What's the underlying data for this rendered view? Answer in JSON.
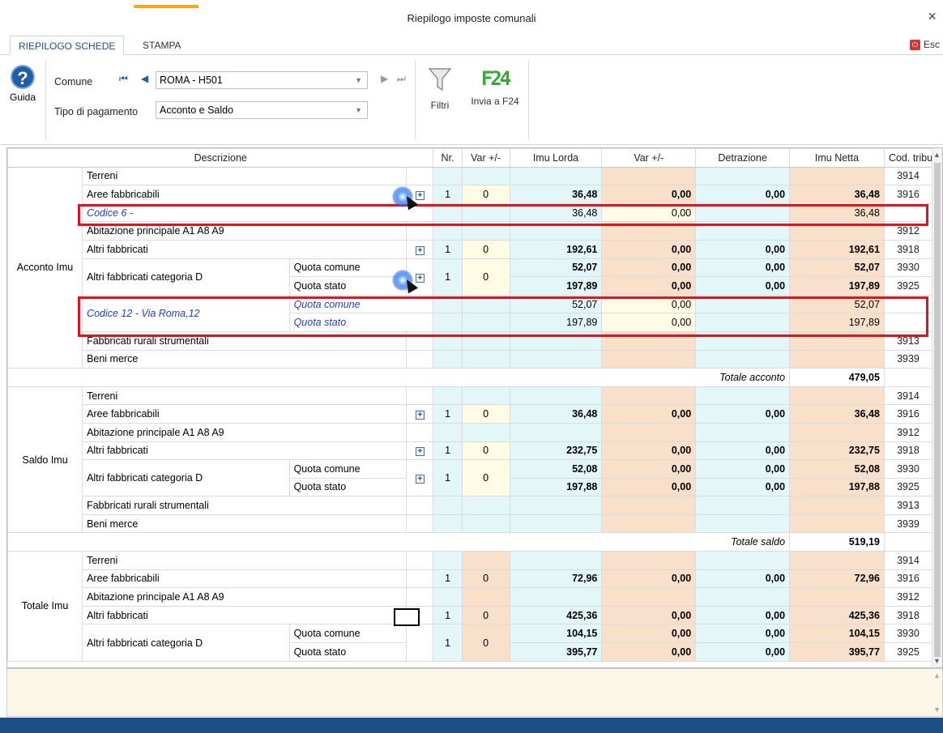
{
  "window": {
    "title": "Riepilogo imposte comunali",
    "close": "×"
  },
  "tabs": {
    "riepilogo": "RIEPILOGO SCHEDE",
    "stampa": "STAMPA",
    "esc": "Esc"
  },
  "ribbon": {
    "guida": "Guida",
    "comune_label": "Comune",
    "comune_value": "ROMA - H501",
    "tipo_label": "Tipo di pagamento",
    "tipo_value": "Acconto e Saldo",
    "filtri": "Filtri",
    "invia": "Invia a F24",
    "f24_icon_text": "F24"
  },
  "columns": [
    "Descrizione",
    "Nr.",
    "Var +/-",
    "Imu Lorda",
    "Var +/-",
    "Detrazione",
    "Imu Netta",
    "Cod. tributo"
  ],
  "acconto": {
    "group": "Acconto Imu",
    "terreni": {
      "desc": "Terreni",
      "cod": "3914"
    },
    "aree": {
      "desc": "Aree fabbricabili",
      "nr": "1",
      "var": "0",
      "lorda": "36,48",
      "var2": "0,00",
      "detr": "0,00",
      "netta": "36,48",
      "cod": "3916"
    },
    "codice6": {
      "desc": "Codice 6 -",
      "lorda": "36,48",
      "var2": "0,00",
      "netta": "36,48"
    },
    "abitazione": {
      "desc": "Abitazione principale A1 A8 A9",
      "cod": "3912"
    },
    "altri": {
      "desc": "Altri fabbricati",
      "nr": "1",
      "var": "0",
      "lorda": "192,61",
      "var2": "0,00",
      "detr": "0,00",
      "netta": "192,61",
      "cod": "3918"
    },
    "catD": {
      "desc": "Altri fabbricati categoria D",
      "nr": "1",
      "var": "0",
      "q1": {
        "label": "Quota comune",
        "lorda": "52,07",
        "var2": "0,00",
        "detr": "0,00",
        "netta": "52,07",
        "cod": "3930"
      },
      "q2": {
        "label": "Quota stato",
        "lorda": "197,89",
        "var2": "0,00",
        "detr": "0,00",
        "netta": "197,89",
        "cod": "3925"
      }
    },
    "codice12": {
      "desc": "Codice 12 - Via Roma,12",
      "q1": {
        "label": "Quota comune",
        "lorda": "52,07",
        "var2": "0,00",
        "netta": "52,07"
      },
      "q2": {
        "label": "Quota stato",
        "lorda": "197,89",
        "var2": "0,00",
        "netta": "197,89"
      }
    },
    "rurali": {
      "desc": "Fabbricati rurali strumentali",
      "cod": "3913"
    },
    "beni": {
      "desc": "Beni merce",
      "cod": "3939"
    },
    "totale_label": "Totale acconto",
    "totale": "479,05"
  },
  "saldo": {
    "group": "Saldo Imu",
    "terreni": {
      "desc": "Terreni",
      "cod": "3914"
    },
    "aree": {
      "desc": "Aree fabbricabili",
      "nr": "1",
      "var": "0",
      "lorda": "36,48",
      "var2": "0,00",
      "detr": "0,00",
      "netta": "36,48",
      "cod": "3916"
    },
    "abitazione": {
      "desc": "Abitazione principale A1 A8 A9",
      "cod": "3912"
    },
    "altri": {
      "desc": "Altri fabbricati",
      "nr": "1",
      "var": "0",
      "lorda": "232,75",
      "var2": "0,00",
      "detr": "0,00",
      "netta": "232,75",
      "cod": "3918"
    },
    "catD": {
      "desc": "Altri fabbricati categoria D",
      "nr": "1",
      "var": "0",
      "q1": {
        "label": "Quota comune",
        "lorda": "52,08",
        "var2": "0,00",
        "detr": "0,00",
        "netta": "52,08",
        "cod": "3930"
      },
      "q2": {
        "label": "Quota stato",
        "lorda": "197,88",
        "var2": "0,00",
        "detr": "0,00",
        "netta": "197,88",
        "cod": "3925"
      }
    },
    "rurali": {
      "desc": "Fabbricati rurali strumentali",
      "cod": "3913"
    },
    "beni": {
      "desc": "Beni merce",
      "cod": "3939"
    },
    "totale_label": "Totale saldo",
    "totale": "519,19"
  },
  "totale": {
    "group": "Totale Imu",
    "terreni": {
      "desc": "Terreni",
      "cod": "3914"
    },
    "aree": {
      "desc": "Aree fabbricabili",
      "nr": "1",
      "var": "0",
      "lorda": "72,96",
      "var2": "0,00",
      "detr": "0,00",
      "netta": "72,96",
      "cod": "3916"
    },
    "abitazione": {
      "desc": "Abitazione principale A1 A8 A9",
      "cod": "3912"
    },
    "altri": {
      "desc": "Altri fabbricati",
      "nr": "1",
      "var": "0",
      "lorda": "425,36",
      "var2": "0,00",
      "detr": "0,00",
      "netta": "425,36",
      "cod": "3918"
    },
    "catD": {
      "desc": "Altri fabbricati categoria D",
      "nr": "1",
      "var": "0",
      "q1": {
        "label": "Quota comune",
        "lorda": "104,15",
        "var2": "0,00",
        "detr": "0,00",
        "netta": "104,15",
        "cod": "3930"
      },
      "q2": {
        "label": "Quota stato",
        "lorda": "395,77",
        "var2": "0,00",
        "detr": "0,00",
        "netta": "395,77",
        "cod": "3925"
      }
    }
  },
  "colors": {
    "cyan": "#e3f7f9",
    "peach": "#f9e0cb",
    "yellow": "#fffbe4",
    "highlight": "#e0141e",
    "statusbar": "#1e4e86"
  }
}
